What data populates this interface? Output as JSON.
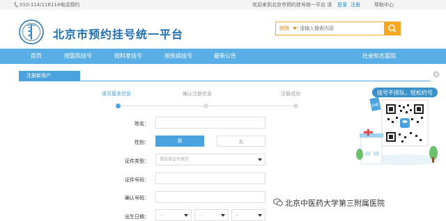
{
  "topbar": {
    "phone": "010-114/116114电话预约",
    "welcome": "欢迎来到北京市预约挂号统一平台 请",
    "login": "登录",
    "register": "注册",
    "help": "帮助中心"
  },
  "header": {
    "site_title": "北京市预约挂号统一平台",
    "search_category": "医院",
    "search_placeholder": "请输入搜索内容"
  },
  "nav": {
    "items": [
      "首页",
      "按医院挂号",
      "按科室挂号",
      "按疾病挂号",
      "最新公告",
      "社会知名医院"
    ]
  },
  "panel": {
    "title": "注册新用户"
  },
  "steps": {
    "items": [
      "填写基本信息",
      "确认注册信息",
      "注册成功"
    ]
  },
  "form": {
    "name_label": "姓名：",
    "gender_label": "性别：",
    "gender_male": "男",
    "gender_female": "女",
    "id_type_label": "证件类型：",
    "id_type_placeholder": "请选择证件类型",
    "id_number_label": "证件号码：",
    "confirm_label": "确认号码：",
    "birth_label": "出生日期：",
    "birth_placeholder": "--"
  },
  "promo": {
    "banner": "挂号不排队，轻松约号",
    "sticker": "扫我"
  },
  "watermark": {
    "text": "北京中医药大学第三附属医院"
  },
  "colors": {
    "brand_blue": "#1f6fb0",
    "nav_blue": "#5aaee6",
    "accent_orange": "#f5a623",
    "active_step": "#4aa3df"
  }
}
